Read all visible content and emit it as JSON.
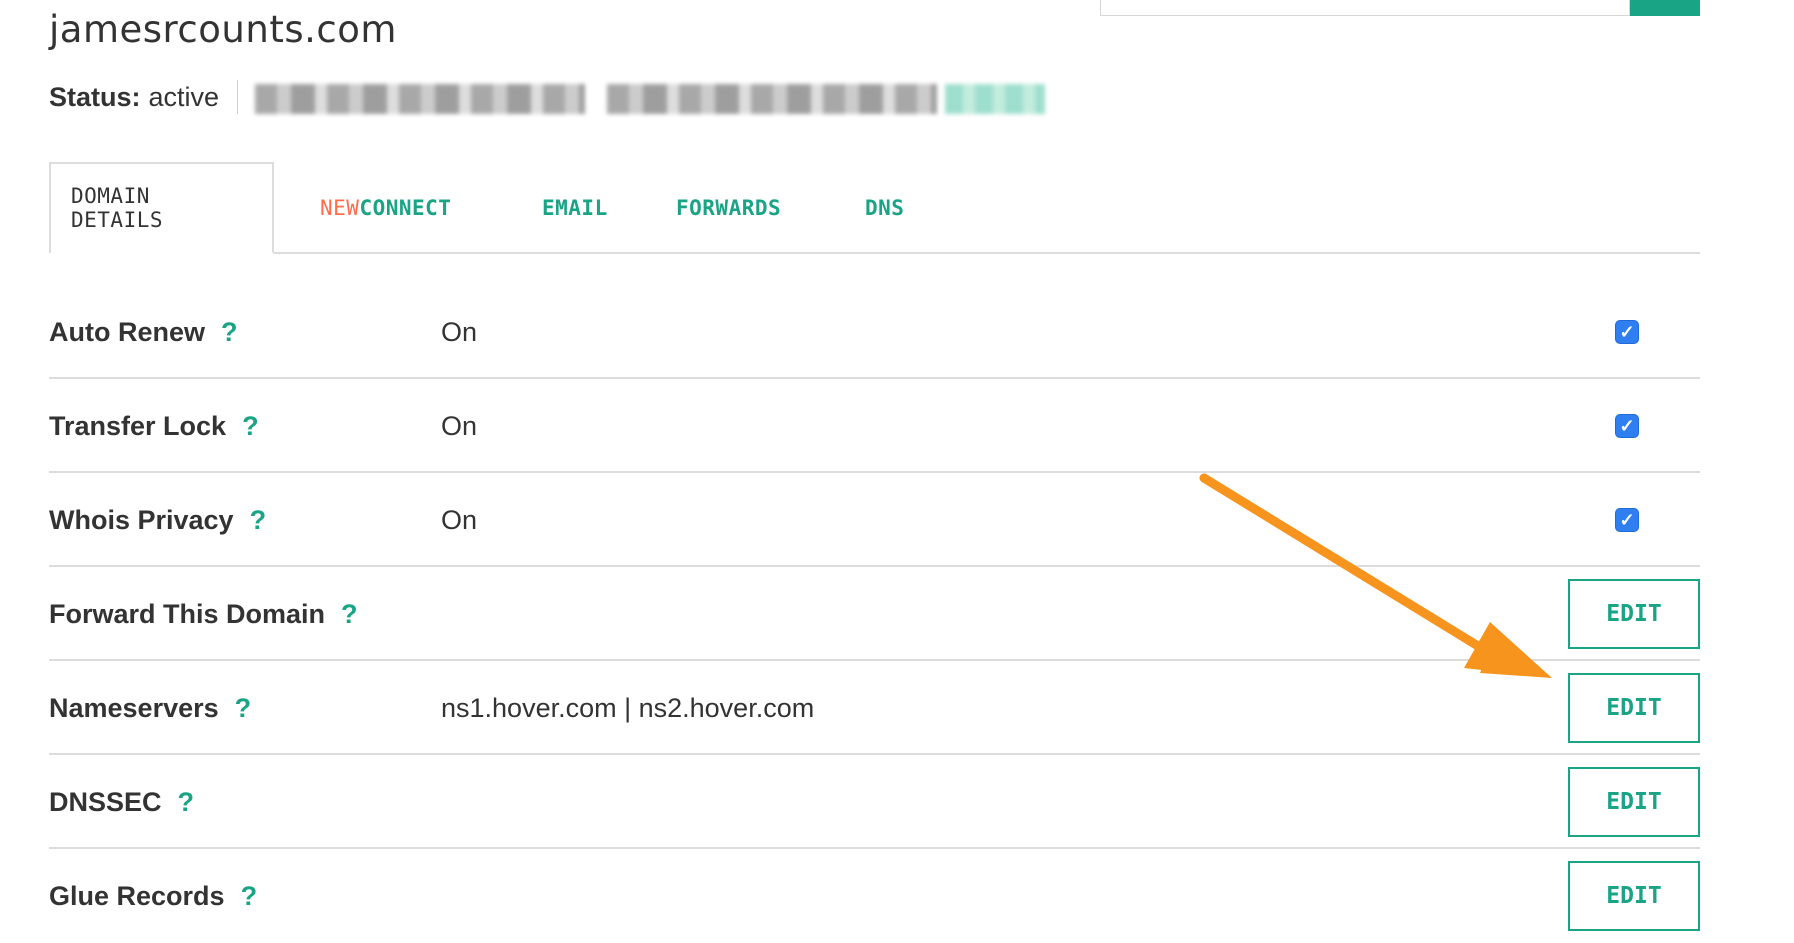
{
  "domain": {
    "title": "jamesrcounts.com"
  },
  "status": {
    "label": "Status:",
    "value": "active"
  },
  "tabs": [
    {
      "label": "DOMAIN DETAILS"
    },
    {
      "label_new": "NEW",
      "label_rest": " CONNECT"
    },
    {
      "label": "EMAIL"
    },
    {
      "label": "FORWARDS"
    },
    {
      "label": "DNS"
    }
  ],
  "details": {
    "help_glyph": "?",
    "edit_label": "EDIT",
    "check_glyph": "✓",
    "rows": [
      {
        "label": "Auto Renew",
        "value": "On",
        "control": "checkbox",
        "checked": true
      },
      {
        "label": "Transfer Lock",
        "value": "On",
        "control": "checkbox",
        "checked": true
      },
      {
        "label": "Whois Privacy",
        "value": "On",
        "control": "checkbox",
        "checked": true
      },
      {
        "label": "Forward This Domain",
        "value": "",
        "control": "edit"
      },
      {
        "label": "Nameservers",
        "value": "ns1.hover.com | ns2.hover.com",
        "control": "edit"
      },
      {
        "label": "DNSSEC",
        "value": "",
        "control": "edit"
      },
      {
        "label": "Glue Records",
        "value": "",
        "control": "edit"
      }
    ]
  },
  "colors": {
    "accent": "#1aa486",
    "new_badge": "#ff6d4a",
    "checkbox": "#2f7ff0",
    "annotation_arrow": "#f7941d"
  }
}
